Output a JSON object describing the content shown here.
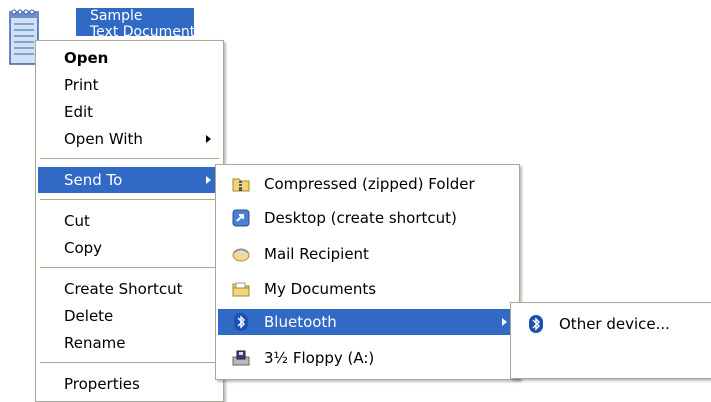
{
  "desktop_file": {
    "label_line1": "Sample",
    "label_line2": "Text Document",
    "icon": "notepad-text-document-icon"
  },
  "context_menu": {
    "items": [
      {
        "label": "Open",
        "bold": true
      },
      {
        "label": "Print"
      },
      {
        "label": "Edit"
      },
      {
        "label": "Open With",
        "submenu": true
      },
      {
        "label": "Send To",
        "submenu": true,
        "selected": true
      },
      {
        "label": "Cut"
      },
      {
        "label": "Copy"
      },
      {
        "label": "Create Shortcut"
      },
      {
        "label": "Delete"
      },
      {
        "label": "Rename"
      },
      {
        "label": "Properties"
      }
    ]
  },
  "send_to_menu": {
    "items": [
      {
        "label": "Compressed (zipped) Folder",
        "icon": "zipped-folder-icon"
      },
      {
        "label": "Desktop (create shortcut)",
        "icon": "desktop-shortcut-icon"
      },
      {
        "label": "Mail Recipient",
        "icon": "mail-recipient-icon"
      },
      {
        "label": "My Documents",
        "icon": "my-documents-folder-icon"
      },
      {
        "label": "Bluetooth",
        "icon": "bluetooth-icon",
        "selected": true,
        "submenu": true
      },
      {
        "label": "3½ Floppy (A:)",
        "icon": "floppy-drive-icon"
      }
    ]
  },
  "bluetooth_menu": {
    "items": [
      {
        "label": "Other device...",
        "icon": "bluetooth-icon"
      }
    ]
  },
  "colors": {
    "selection": "#316ac5",
    "menu_border": "#aca899"
  }
}
